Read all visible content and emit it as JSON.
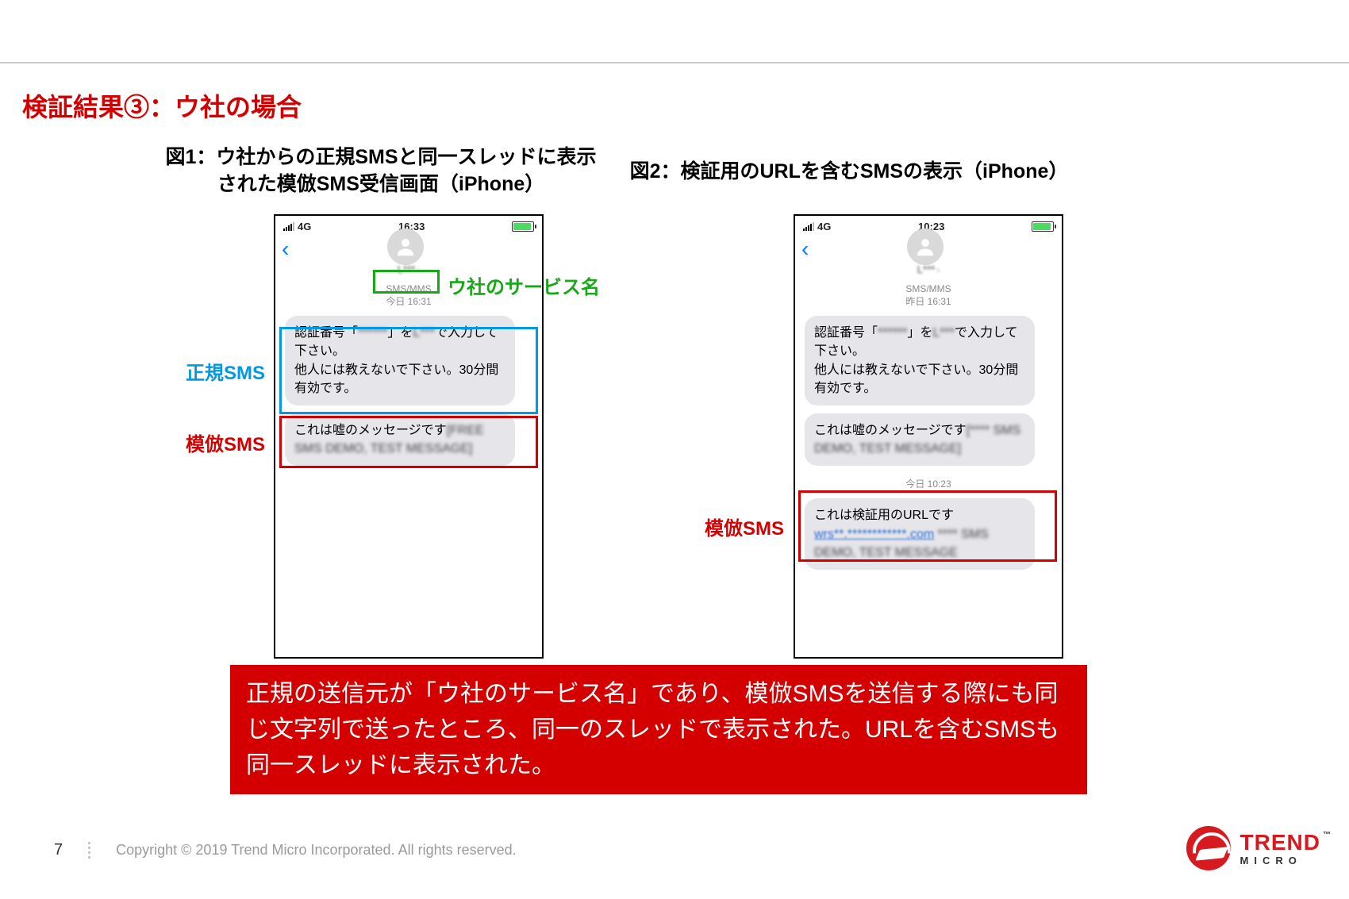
{
  "title": "検証結果③：ウ社の場合",
  "fig1": {
    "caption": "図1：ウ社からの正規SMSと同一スレッドに表示\nされた模倣SMS受信画面（iPhone）",
    "statusbar": {
      "carrier": "4G",
      "time": "16:33"
    },
    "contact_blur": "L***",
    "meta_type": "SMS/MMS",
    "meta_date": "今日 16:31",
    "msg1": {
      "prefix": "認証番号「",
      "code_blur": "******",
      "mid": "」を",
      "svc_blur": "L***",
      "suffix": "で入力して下さい。\n他人には教えないで下さい。30分間有効です。"
    },
    "msg2": {
      "prefix": "これは嘘のメッセージです",
      "blur": "[FREE SMS DEMO, TEST MESSAGE]"
    }
  },
  "fig2": {
    "caption": "図2：検証用のURLを含むSMSの表示（iPhone）",
    "statusbar": {
      "carrier": "4G",
      "time": "10:23"
    },
    "contact_blur": "L***",
    "meta_type": "SMS/MMS",
    "meta_date": "昨日 16:31",
    "msg1": {
      "prefix": "認証番号「",
      "code_blur": "******",
      "mid": "」を",
      "svc_blur": "L***",
      "suffix": "で入力して下さい。\n他人には教えないで下さい。30分間有効です。"
    },
    "msg2": {
      "prefix": "これは嘘のメッセージです",
      "blur": "[**** SMS DEMO, TEST MESSAGE]"
    },
    "sep": "今日 10:23",
    "msg3": {
      "line1": "これは検証用のURLです",
      "url_blur": "wrs**.************.com",
      "tail_blur": " **** SMS DEMO, TEST MESSAGE"
    }
  },
  "annotations": {
    "service_name": "ウ社のサービス名",
    "legit_sms": "正規SMS",
    "fake_sms": "模倣SMS"
  },
  "banner": "正規の送信元が「ウ社のサービス名」であり、模倣SMSを送信する際にも同じ文字列で送ったところ、同一のスレッドで表示された。URLを含むSMSも同一スレッドに表示された。",
  "footer": {
    "page": "7",
    "copyright": "Copyright © 2019 Trend Micro Incorporated. All rights reserved."
  },
  "logo": {
    "brand": "TREND",
    "sub": "MICRO",
    "tm": "™"
  }
}
